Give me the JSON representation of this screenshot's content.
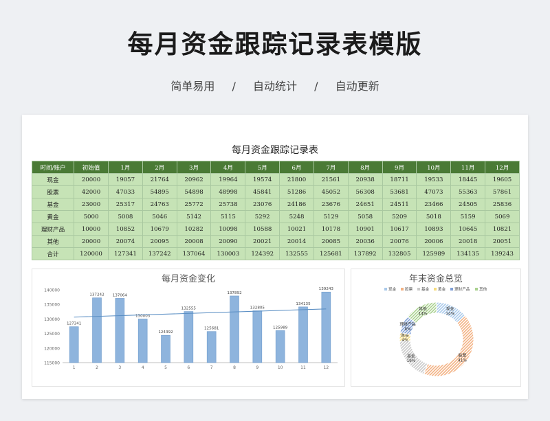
{
  "page": {
    "title": "每月资金跟踪记录表模版",
    "features": [
      "简单易用",
      "自动统计",
      "自动更新"
    ],
    "separator": "/"
  },
  "sheet": {
    "title": "每月资金跟踪记录表",
    "headers": [
      "时间/账户",
      "初始值",
      "1月",
      "2月",
      "3月",
      "4月",
      "5月",
      "6月",
      "7月",
      "8月",
      "9月",
      "10月",
      "11月",
      "12月"
    ],
    "rows": [
      [
        "现金",
        "20000",
        "19057",
        "21764",
        "20962",
        "19964",
        "19574",
        "21800",
        "21561",
        "20938",
        "18711",
        "19533",
        "18445",
        "19605"
      ],
      [
        "股票",
        "42000",
        "47033",
        "54895",
        "54898",
        "48998",
        "45841",
        "51286",
        "45052",
        "56308",
        "53681",
        "47073",
        "55363",
        "57861"
      ],
      [
        "基金",
        "23000",
        "25317",
        "24763",
        "25772",
        "25738",
        "23076",
        "24186",
        "23676",
        "24651",
        "24511",
        "23466",
        "24505",
        "25836"
      ],
      [
        "黄金",
        "5000",
        "5008",
        "5046",
        "5142",
        "5115",
        "5292",
        "5248",
        "5129",
        "5058",
        "5209",
        "5018",
        "5159",
        "5069"
      ],
      [
        "理财产品",
        "10000",
        "10852",
        "10679",
        "10282",
        "10098",
        "10588",
        "10021",
        "10178",
        "10901",
        "10617",
        "10893",
        "10645",
        "10821"
      ],
      [
        "其他",
        "20000",
        "20074",
        "20095",
        "20008",
        "20090",
        "20021",
        "20014",
        "20085",
        "20036",
        "20076",
        "20006",
        "20018",
        "20051"
      ],
      [
        "合计",
        "120000",
        "127341",
        "137242",
        "137064",
        "130003",
        "124392",
        "132555",
        "125681",
        "137892",
        "132805",
        "125989",
        "134135",
        "139243"
      ]
    ]
  },
  "chart_data": [
    {
      "type": "bar",
      "title": "每月资金变化",
      "categories": [
        "1",
        "2",
        "3",
        "4",
        "5",
        "6",
        "7",
        "8",
        "9",
        "10",
        "11",
        "12"
      ],
      "values": [
        127341,
        137242,
        137064,
        130003,
        124392,
        132555,
        125681,
        137892,
        132805,
        125989,
        134135,
        139243
      ],
      "ylim": [
        115000,
        140000
      ],
      "yticks": [
        "115000",
        "120000",
        "125000",
        "130000",
        "135000",
        "140000"
      ],
      "trendline": true,
      "grid": false,
      "colors": {
        "bar": "#8eb4dd",
        "bar_edge": "#6f9bcc",
        "trend": "#5b8fc4"
      }
    },
    {
      "type": "pie",
      "title": "年末资金总览",
      "labels": [
        "现金",
        "股票",
        "基金",
        "黄金",
        "理财产品",
        "其他"
      ],
      "values": [
        19605,
        57861,
        25836,
        5069,
        10821,
        20051
      ],
      "percent_labels": [
        "14%",
        "41%",
        "19%",
        "4%",
        "8%",
        "14%"
      ],
      "legend": "top",
      "colors": [
        "#a9c9ea",
        "#f3b182",
        "#c9c9c9",
        "#f6dc7e",
        "#7f9fd6",
        "#a9d18e"
      ]
    }
  ]
}
